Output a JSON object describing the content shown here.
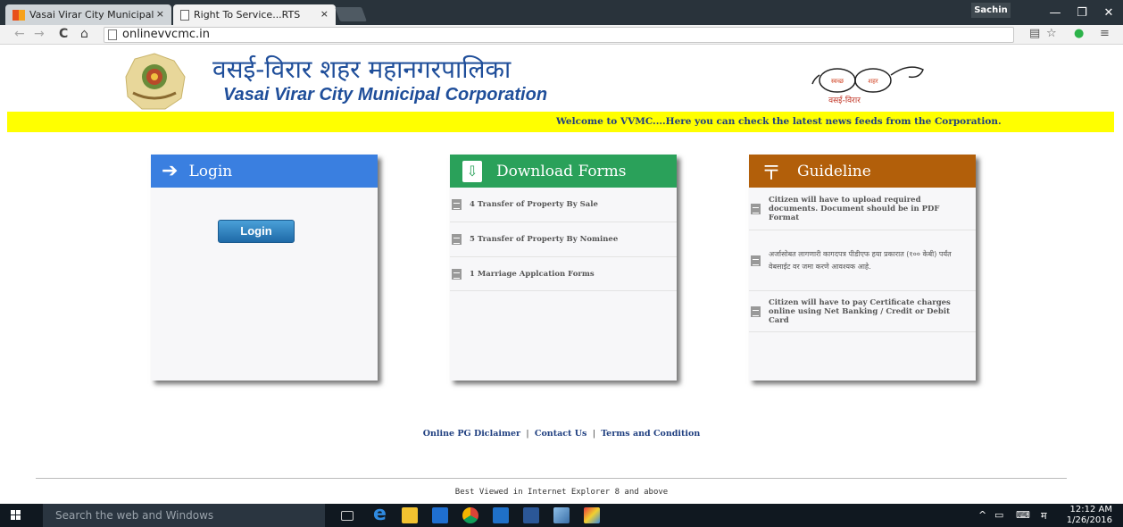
{
  "browser": {
    "tabs": [
      {
        "label": "Vasai Virar City Municipal",
        "close": "×"
      },
      {
        "label": "Right To Service...RTS",
        "close": "×"
      }
    ],
    "user": "Sachin",
    "window_controls": {
      "minimize": "—",
      "restore": "❐",
      "close": "✕"
    },
    "url": "onlinevvcmc.in"
  },
  "header": {
    "title_marathi": "वसई-विरार शहर महानगरपालिका",
    "title_english": "Vasai Virar City Municipal Corporation",
    "swachh_left": "स्वच्छ",
    "swachh_right": "शहर",
    "swachh_caption": "वसई-विरार"
  },
  "marquee": "Welcome to VVMC....Here you can check the latest news feeds from the Corporation.",
  "panels": {
    "login": {
      "title": "Login",
      "button": "Login"
    },
    "download": {
      "title": "Download Forms",
      "items": [
        "4 Transfer of Property By Sale",
        "5 Transfer of Property By Nominee",
        "1 Marriage Applcation Forms"
      ]
    },
    "guideline": {
      "title": "Guideline",
      "items": [
        "Citizen will have to upload required documents. Document should be in PDF Format",
        "अर्जासोबत लागणारी कागदपत्र पीडीएफ हया प्रकारात (१०० केबी) पर्यंत वेबसाईट वर जमा करणे आवश्यक आहे.",
        "Citizen will have to pay Certificate charges online using Net Banking / Credit or Debit Card"
      ]
    }
  },
  "footer": {
    "links": [
      "Online PG Diclaimer",
      "Contact Us",
      "Terms and Condition"
    ],
    "separator": "|",
    "best_viewed": "Best Viewed in Internet Explorer 8 and above"
  },
  "taskbar": {
    "search_placeholder": "Search the web and Windows",
    "ime": "म",
    "time": "12:12 AM",
    "date": "1/26/2016"
  },
  "colors": {
    "login_head": "#3a7fe0",
    "download_head": "#2aa15a",
    "guideline_head": "#b25f0a",
    "marquee_bg": "#ffff00",
    "title_blue": "#1f4e9a"
  }
}
